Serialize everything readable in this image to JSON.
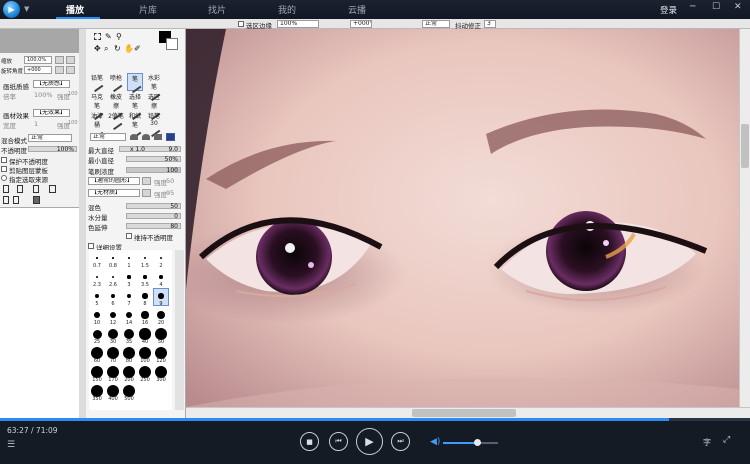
{
  "app": {
    "tabs": [
      {
        "label": "播放"
      },
      {
        "label": "片库"
      },
      {
        "label": "找片"
      },
      {
        "label": "我的"
      },
      {
        "label": "云播"
      }
    ],
    "login": "登录",
    "window_buttons": [
      "─",
      "☐",
      "✕"
    ]
  },
  "sai": {
    "top": {
      "checkbox_label": "选区边缘",
      "zoom": "100%",
      "angle": "+000°",
      "mode": "正常",
      "stab_label": "抖动修正",
      "stab_value": "3"
    },
    "nav": {
      "zoom_label": "缩放",
      "zoom_value": "100.0%",
      "angle_label": "旋转角度",
      "angle_value": "+000"
    },
    "layer": {
      "paper_label": "画纸质感",
      "paper_value": "【无质感】",
      "scale_label": "倍率",
      "scale_value": "100%",
      "strength_label": "强度",
      "strength_value": "100",
      "effect_label": "画材效果",
      "effect_value": "【无效果】",
      "width_label": "宽度",
      "width_value": "1",
      "strength2_value": "100",
      "blend_label": "混合模式",
      "blend_value": "正常",
      "opacity_label": "不透明度",
      "opacity_value": "100%",
      "protect": "保护不透明度",
      "clip": "剪贴图层蒙板",
      "select_src": "指定选取来源"
    },
    "tools": [
      "铅笔",
      "喷枪",
      "笔",
      "水彩笔",
      "马克笔",
      "橡皮擦",
      "选择笔",
      "选区擦",
      "油漆桶",
      "2值笔",
      "和纸笔",
      "铅笔30"
    ],
    "brush": {
      "mode": "正常",
      "max_label": "最大直径",
      "max_value": "x 1.0",
      "max_num": "9.0",
      "min_label": "最小直径",
      "min_value": "50%",
      "density_label": "笔刷浓度",
      "density_value": "100",
      "shape_value": "【通常的圆形】",
      "shape_num": "50",
      "texture_value": "【无材质】",
      "texture_num": "95",
      "mix_label": "混色",
      "mix_value": "50",
      "water_label": "水分量",
      "water_value": "0",
      "keep_label": "色延伸",
      "keep_value": "80",
      "keep_opacity": "维持不透明度",
      "detail": "详细设置"
    },
    "brush_sizes": [
      "0.7",
      "0.8",
      "1",
      "1.5",
      "2",
      "2.3",
      "2.6",
      "3",
      "3.5",
      "4",
      "5",
      "6",
      "7",
      "8",
      "9",
      "10",
      "12",
      "14",
      "16",
      "20",
      "25",
      "30",
      "35",
      "40",
      "50",
      "60",
      "70",
      "80",
      "100",
      "120",
      "150",
      "170",
      "200",
      "250",
      "300",
      "350",
      "400",
      "500"
    ]
  },
  "player": {
    "current_time": "63:27",
    "total_time": "71:09",
    "time_sep": " / ",
    "progress": 0.892,
    "volume": 0.62,
    "subtitle_btn": "字"
  },
  "colors": {
    "accent": "#2e8cf0"
  }
}
